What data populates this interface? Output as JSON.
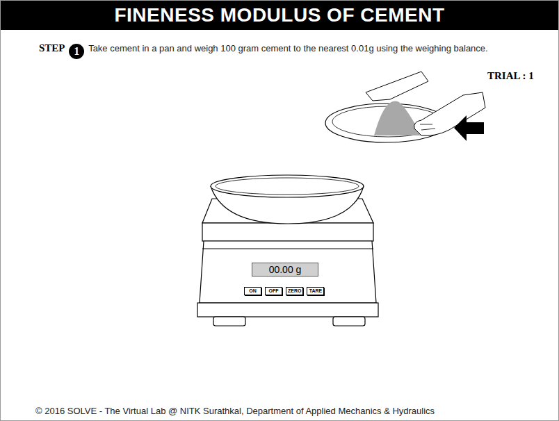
{
  "title": "FINENESS MODULUS OF CEMENT",
  "step": {
    "label": "STEP",
    "number": "1",
    "instruction": "Take cement in a pan and weigh 100 gram cement to the nearest 0.01g using the weighing balance."
  },
  "trial": "TRIAL : 1",
  "balance": {
    "display": "00.00 g",
    "buttons": [
      "ON",
      "OFF",
      "ZERO",
      "TARE"
    ]
  },
  "footer": "© 2016 SOLVE - The Virtual Lab @ NITK Surathkal, Department of Applied Mechanics & Hydraulics"
}
